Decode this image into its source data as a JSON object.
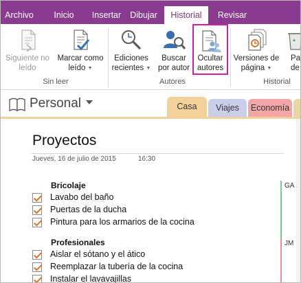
{
  "ribbon_tabs": [
    "Archivo",
    "Inicio",
    "Insertar",
    "Dibujar",
    "Historial",
    "Revisar"
  ],
  "active_tab": "Historial",
  "colors": {
    "accent": "#8a3b8f",
    "highlight": "#d11ea8",
    "check": "#e0701f",
    "author_ga": "#7dc993",
    "author_jm": "#f08c8c"
  },
  "ribbon": {
    "groups": {
      "sin_leer": "Sin leer",
      "autores": "Autores",
      "historial": "Historial"
    },
    "buttons": {
      "next_unread": {
        "line1": "Siguiente no",
        "line2": "leído",
        "icon": "next-unread-icon"
      },
      "mark_read": {
        "line1": "Marcar como",
        "line2": "leído",
        "icon": "mark-read-icon"
      },
      "recent_edits": {
        "line1": "Ediciones",
        "line2": "recientes",
        "icon": "recent-edits-icon"
      },
      "find_author": {
        "line1": "Buscar",
        "line2": "por autor",
        "icon": "find-author-icon"
      },
      "hide_authors": {
        "line1": "Ocultar",
        "line2": "autores",
        "icon": "hide-authors-icon"
      },
      "page_versions": {
        "line1": "Versiones de",
        "line2": "página",
        "icon": "page-versions-icon"
      },
      "recycle_bin": {
        "line1": "Pap",
        "line2": "de",
        "icon": "recycle-bin-icon"
      }
    }
  },
  "notebook": {
    "name": "Personal",
    "sections": [
      "Casa",
      "Viajes",
      "Economía"
    ]
  },
  "page": {
    "title": "Proyectos",
    "date": "Jueves, 16 de julio de 2015",
    "time": "16:30",
    "sections": [
      {
        "heading": "Bricolaje",
        "author": "GA",
        "tasks": [
          "Lavabo del baño",
          "Puertas de la ducha",
          "Pintura para los armarios de la cocina"
        ]
      },
      {
        "heading": "Profesionales",
        "author": "JM",
        "tasks": [
          "Aislar el sótano y el ático",
          "Reemplazar la tubería de la cocina",
          "Instalar el lavavajillas"
        ]
      }
    ]
  }
}
